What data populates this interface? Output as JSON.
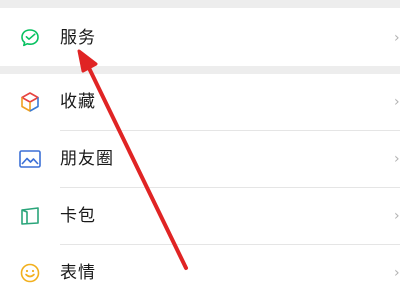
{
  "menu": {
    "items": [
      {
        "id": "services",
        "label": "服务",
        "icon": "wechat-pay-icon"
      },
      {
        "id": "favorites",
        "label": "收藏",
        "icon": "cube-favorites-icon"
      },
      {
        "id": "moments",
        "label": "朋友圈",
        "icon": "image-moments-icon"
      },
      {
        "id": "cards",
        "label": "卡包",
        "icon": "wallet-card-icon"
      },
      {
        "id": "stickers",
        "label": "表情",
        "icon": "smiley-sticker-icon"
      }
    ]
  },
  "colors": {
    "background": "#ededed",
    "row_background": "#ffffff",
    "text": "#191919",
    "divider": "#e5e5e5",
    "annotation_arrow": "#e02424",
    "services_icon": "#07c160"
  }
}
